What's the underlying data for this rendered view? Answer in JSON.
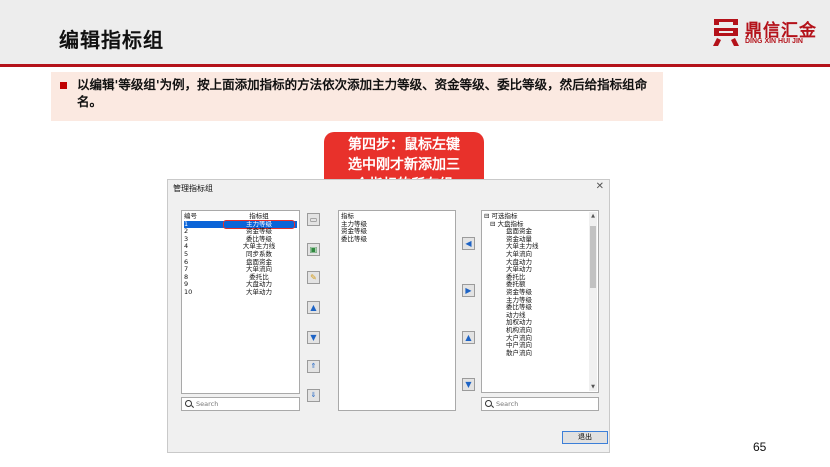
{
  "slide": {
    "title": "编辑指标组",
    "page_number": "65",
    "accent_color": "#b4121a"
  },
  "logo": {
    "name_cn": "鼎信汇金",
    "name_en": "DING XIN HUI JIN"
  },
  "note": {
    "text": "以编辑'等级组'为例，按上面添加指标的方法依次添加主力等级、资金等级、委比等级，然后给指标组命名。"
  },
  "callout": {
    "text": "第四步：鼠标左键\n选中刚才新添加三\n个指标的所在组"
  },
  "dialog": {
    "title": "管理指标组",
    "close_icon": "close-icon",
    "group_list": {
      "columns": [
        "编号",
        "指标组"
      ],
      "rows": [
        {
          "no": "1",
          "name": "主力等级",
          "selected": true
        },
        {
          "no": "2",
          "name": "资金等级"
        },
        {
          "no": "3",
          "name": "委比等级"
        },
        {
          "no": "4",
          "name": "大单主力线"
        },
        {
          "no": "5",
          "name": "同步系数"
        },
        {
          "no": "6",
          "name": "盘面资金"
        },
        {
          "no": "7",
          "name": "大单流向"
        },
        {
          "no": "8",
          "name": "委托比"
        },
        {
          "no": "9",
          "name": "大盘动力"
        },
        {
          "no": "10",
          "name": "大单动力"
        }
      ],
      "search_placeholder": "Search"
    },
    "toolbar_icons": [
      "new-icon",
      "copy-icon",
      "edit-icon",
      "move-up-icon",
      "move-down-icon",
      "move-top-icon",
      "move-bottom-icon"
    ],
    "indicator_list": {
      "header": "指标",
      "items": [
        "主力等级",
        "资金等级",
        "委比等级"
      ]
    },
    "transfer_icons": [
      "arrow-left-icon",
      "arrow-right-icon",
      "arrow-up-icon",
      "arrow-down-icon"
    ],
    "tree": {
      "root": "可选指标",
      "group": "大盘指标",
      "items": [
        "盘面资金",
        "资金动量",
        "大单主力线",
        "大单流向",
        "大盘动力",
        "大单动力",
        "委托比",
        "委托额",
        "资金等级",
        "主力等级",
        "委比等级",
        "动力线",
        "加权动力",
        "机构流向",
        "大户流向",
        "中户流向",
        "散户流向"
      ],
      "search_placeholder": "Search"
    },
    "exit_label": "退出"
  }
}
